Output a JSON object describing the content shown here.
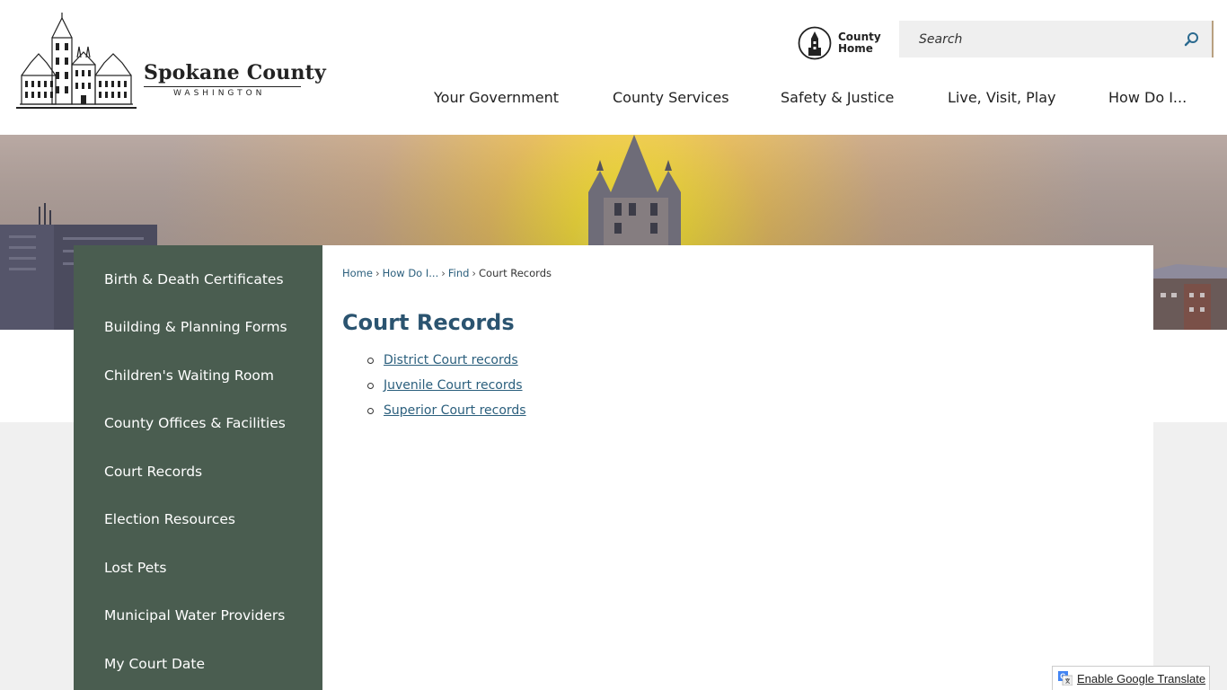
{
  "brand": {
    "name": "Spokane County",
    "subtitle": "WASHINGTON"
  },
  "header": {
    "county_home": {
      "line1": "County",
      "line2": "Home"
    },
    "search": {
      "placeholder": "Search"
    },
    "nav": [
      {
        "label": "Your Government"
      },
      {
        "label": "County Services"
      },
      {
        "label": "Safety & Justice"
      },
      {
        "label": "Live, Visit, Play"
      },
      {
        "label": "How Do I..."
      }
    ]
  },
  "sidebar": {
    "items": [
      {
        "label": "Birth & Death Certificates"
      },
      {
        "label": "Building & Planning Forms"
      },
      {
        "label": "Children's Waiting Room"
      },
      {
        "label": "County Offices & Facilities"
      },
      {
        "label": "Court Records"
      },
      {
        "label": "Election Resources"
      },
      {
        "label": "Lost Pets"
      },
      {
        "label": "Municipal Water Providers"
      },
      {
        "label": "My Court Date"
      }
    ]
  },
  "main": {
    "breadcrumb": [
      {
        "label": "Home"
      },
      {
        "label": "How Do I..."
      },
      {
        "label": "Find"
      },
      {
        "label": "Court Records"
      }
    ],
    "breadcrumb_separator": "›",
    "title": "Court Records",
    "links": [
      {
        "label": "District Court records"
      },
      {
        "label": "Juvenile Court records"
      },
      {
        "label": "Superior Court records"
      }
    ]
  },
  "translate": {
    "label": "Enable Google Translate"
  },
  "colors": {
    "sidebar_bg": "#4a5d50",
    "link": "#2b5f7d",
    "title": "#2b5470"
  }
}
